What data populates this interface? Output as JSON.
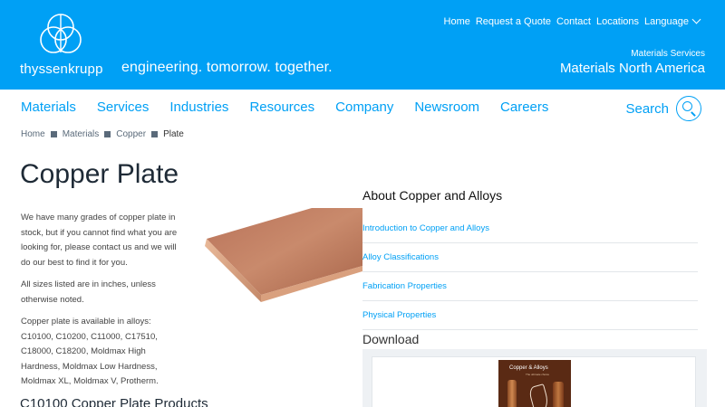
{
  "header": {
    "brand": "thyssenkrupp",
    "tagline": "engineering. tomorrow. together.",
    "top_nav": [
      "Home",
      "Request a Quote",
      "Contact",
      "Locations"
    ],
    "language_label": "Language",
    "region_small": "Materials Services",
    "region_big": "Materials North America",
    "color": "#00a0f5"
  },
  "main_nav": {
    "items": [
      "Materials",
      "Services",
      "Industries",
      "Resources",
      "Company",
      "Newsroom",
      "Careers"
    ],
    "search_label": "Search"
  },
  "breadcrumb": [
    "Home",
    "Materials",
    "Copper",
    "Plate"
  ],
  "page": {
    "title": "Copper Plate",
    "paragraphs": [
      "We have many grades of copper plate in stock, but if you cannot find what you are looking for, please contact us and we will do our best to find it for you.",
      "All sizes listed are in inches, unless otherwise noted.",
      "Copper plate is available in alloys: C10100, C10200, C11000, C17510, C18000, C18200, Moldmax High Hardness, Moldmax Low Hardness, Moldmax XL, Moldmax V, Protherm."
    ],
    "section_heading": "C10100 Copper Plate Products"
  },
  "about": {
    "title": "About Copper and Alloys",
    "links": [
      "Introduction to Copper and Alloys",
      "Alloy Classifications",
      "Fabrication Properties",
      "Physical Properties"
    ]
  },
  "download": {
    "title": "Download",
    "brochure_title": "Copper & Alloys",
    "brochure_sub": "The ultimate choice"
  }
}
